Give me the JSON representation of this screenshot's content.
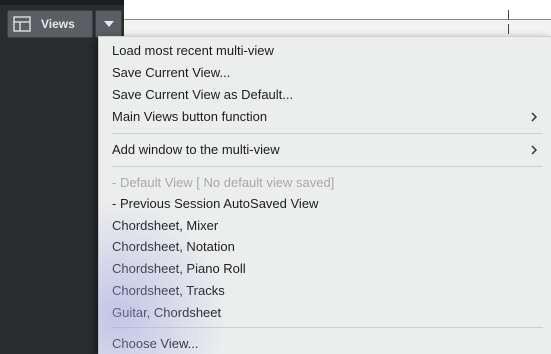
{
  "toolbar": {
    "views_label": "Views"
  },
  "menu": {
    "items": [
      "Load most recent multi-view",
      "Save Current View...",
      "Save Current View as Default...",
      "Main Views button function",
      "Add window to the multi-view",
      "- Default View [ No default view saved]",
      "- Previous Session AutoSaved View",
      "Chordsheet, Mixer",
      "Chordsheet, Notation",
      "Chordsheet, Piano Roll",
      "Chordsheet, Tracks",
      "Guitar, Chordsheet",
      "Choose View..."
    ]
  },
  "icons": {
    "views": "layout-grid-icon",
    "dropdown": "chevron-down-icon",
    "submenu": "chevron-right-icon"
  },
  "colors": {
    "panel": "#2a2c2e",
    "button": "#5b5e62",
    "menu_bg": "#eceded",
    "menu_text": "#1d1d1d",
    "disabled_text": "#a9a9a9"
  }
}
